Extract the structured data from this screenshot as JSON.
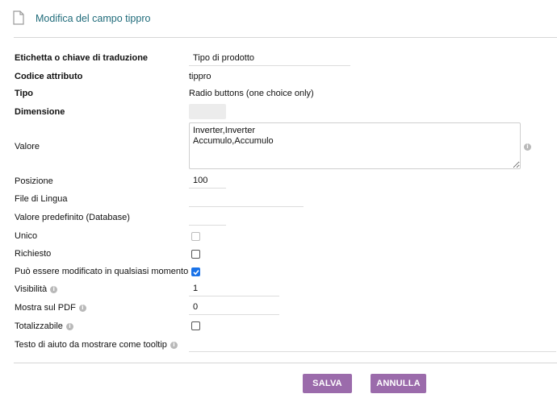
{
  "header": {
    "title": "Modifica del campo tippro",
    "icon": "document-icon"
  },
  "form": {
    "label_key": {
      "label": "Etichetta o chiave di traduzione",
      "value": "Tipo di prodotto"
    },
    "attr_code": {
      "label": "Codice attributo",
      "value": "tippro"
    },
    "type": {
      "label": "Tipo",
      "value": "Radio buttons (one choice only)"
    },
    "dimension": {
      "label": "Dimensione",
      "value": ""
    },
    "value": {
      "label": "Valore",
      "value": "Inverter,Inverter\nAccumulo,Accumulo"
    },
    "position": {
      "label": "Posizione",
      "value": "100"
    },
    "lang_file": {
      "label": "File di Lingua",
      "value": ""
    },
    "default_value": {
      "label": "Valore predefinito (Database)",
      "value": ""
    },
    "unique": {
      "label": "Unico",
      "checked": false,
      "disabled": true
    },
    "required": {
      "label": "Richiesto",
      "checked": false
    },
    "always_editable": {
      "label": "Può essere modificato in qualsiasi momento",
      "checked": true
    },
    "visibility": {
      "label": "Visibilità",
      "value": "1"
    },
    "show_pdf": {
      "label": "Mostra sul PDF",
      "value": "0"
    },
    "totalizable": {
      "label": "Totalizzabile",
      "checked": false
    },
    "tooltip_text": {
      "label": "Testo di aiuto da mostrare come tooltip",
      "value": ""
    }
  },
  "buttons": {
    "save": "SALVA",
    "cancel": "ANNULLA"
  },
  "colors": {
    "title": "#1f6b7a",
    "button": "#9b6bab",
    "checkbox_checked": "#1a73e8"
  }
}
